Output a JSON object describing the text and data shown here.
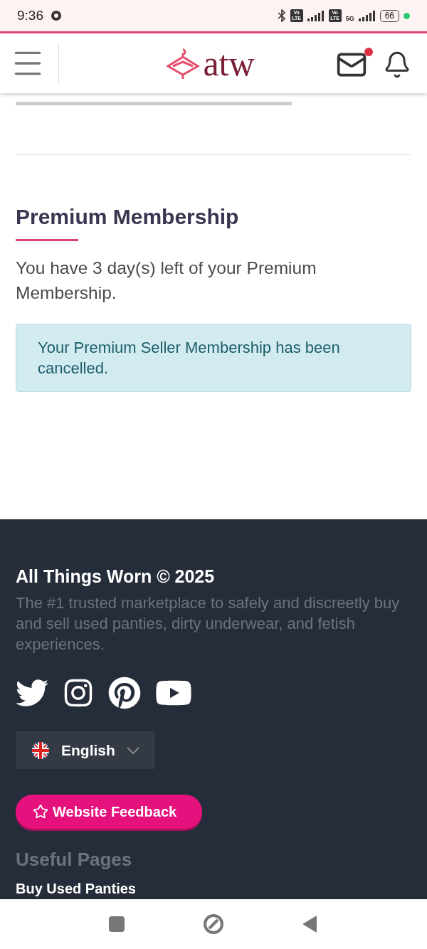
{
  "status_bar": {
    "time": "9:36",
    "badges": [
      "Vo LTE",
      "Vo LTE"
    ],
    "network": "5G",
    "battery": "66"
  },
  "header": {
    "logo": "atw",
    "mail": {
      "unread": true
    }
  },
  "membership": {
    "title": "Premium Membership",
    "text": "You have 3 day(s) left of your Premium Membership.",
    "alert": "Your Premium Seller Membership has been cancelled."
  },
  "footer": {
    "title": "All Things Worn © 2025",
    "description": "The #1 trusted marketplace to safely and discreetly buy and sell used panties, dirty underwear, and fetish experiences.",
    "socials": [
      {
        "kind": "twitter"
      },
      {
        "kind": "instagram"
      },
      {
        "kind": "pinterest"
      },
      {
        "kind": "youtube"
      }
    ],
    "language": "English",
    "feedback": "Website Feedback",
    "useful_pages": {
      "title": "Useful Pages",
      "links": [
        "Buy Used Panties"
      ]
    }
  }
}
